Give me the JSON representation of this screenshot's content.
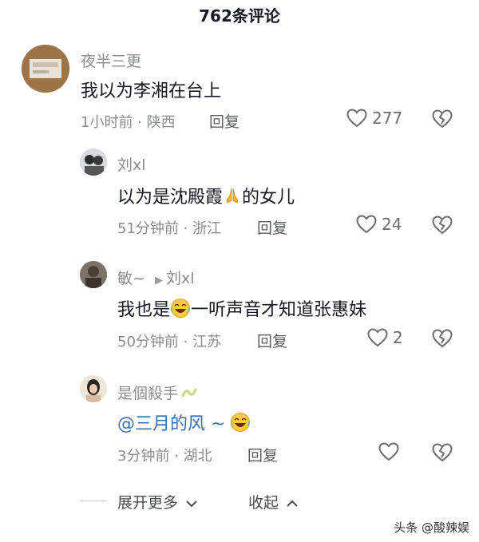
{
  "header": {
    "title": "762条评论"
  },
  "comments": [
    {
      "user": "夜半三更",
      "text": "我以为李湘在台上",
      "time": "1小时前 · 陕西",
      "reply": "回复",
      "likes": "277"
    },
    {
      "user": "刘xl",
      "text_a": "以为是沈殿霞",
      "text_b": "的女儿",
      "emoji": "praying-hands",
      "time": "51分钟前 · 浙江",
      "reply": "回复",
      "likes": "24"
    },
    {
      "user": "敏~",
      "arrow": "▶",
      "reply_to": "刘xl",
      "text_a": "我也是",
      "text_b": "一听声音才知道张惠妹",
      "emoji": "laughing-face",
      "time": "50分钟前 · 江苏",
      "reply": "回复",
      "likes": "2"
    },
    {
      "user": "是個殺手",
      "mention": "@三月的风 ~",
      "emoji": "laughing-face",
      "time": "3分钟前 · 湖北",
      "reply": "回复",
      "likes": ""
    }
  ],
  "footer": {
    "expand": "展开更多",
    "collapse": "收起"
  },
  "watermark": "头条 @酸辣娱"
}
